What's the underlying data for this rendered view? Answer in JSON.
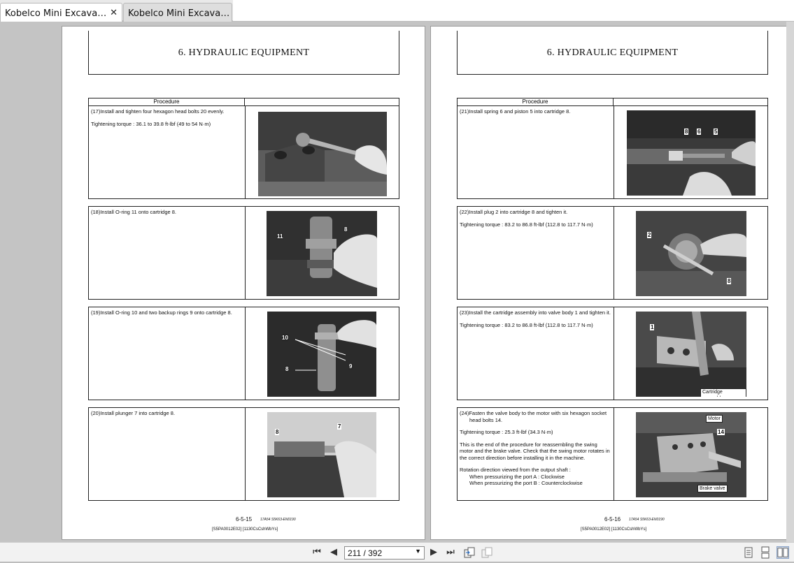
{
  "tabs": [
    {
      "title": "Kobelco Mini Excavator ...",
      "close": "✕"
    },
    {
      "title": "Kobelco Mini Excavato..."
    }
  ],
  "pages": [
    {
      "header": "6. HYDRAULIC EQUIPMENT",
      "column_header": "Procedure",
      "steps": [
        {
          "paragraphs": [
            "(17)Install and tighten four hexagon head bolts 20 evenly.",
            "Tightening torque : 36.1 to 39.8 ft-lbf (49 to 54 N·m)"
          ],
          "callouts": []
        },
        {
          "paragraphs": [
            "(18)Install O-ring 11 onto cartridge 8."
          ],
          "callouts": [
            "11",
            "8"
          ]
        },
        {
          "paragraphs": [
            "(19)Install O-ring 10 and two backup rings 9 onto cartridge 8."
          ],
          "callouts": [
            "10",
            "8",
            "9"
          ]
        },
        {
          "paragraphs": [
            "(20)Install plunger 7 into cartridge 8."
          ],
          "callouts": [
            "8",
            "7"
          ]
        }
      ],
      "page_number": "6-5-15",
      "code": "17A54   S5K63-EN0190",
      "reference": "[S5PA0012E02] [1130CsCshWbYs]"
    },
    {
      "header": "6. HYDRAULIC EQUIPMENT",
      "column_header": "Procedure",
      "steps": [
        {
          "paragraphs": [
            "(21)Install spring 6 and piston 5 into cartridge 8."
          ],
          "callouts": [
            "8",
            "6",
            "5"
          ]
        },
        {
          "paragraphs": [
            "(22)Install plug 2 into cartridge 8 and tighten it.",
            "Tightening torque : 83.2 to 86.8 ft-lbf (112.8 to 117.7 N·m)"
          ],
          "callouts": [
            "2",
            "8"
          ]
        },
        {
          "paragraphs": [
            "(23)Install the cartridge assembly into valve body 1 and tighten it.",
            "Tightening torque : 83.2 to 86.8 ft-lbf (112.8 to 117.7 N·m)"
          ],
          "callouts": [
            "1",
            "Cartridge assembly"
          ]
        },
        {
          "paragraphs": [
            "(24)Fasten the valve body to the motor with six hexagon socket head bolts 14.",
            "Tightening torque : 25.3 ft-lbf (34.3 N·m)",
            "This is the end of the procedure for reassembling the swing motor and the brake valve. Check that the swing motor rotates in the correct direction before installing it in the machine.",
            "Rotation direction viewed from the output shaft :",
            "When pressurizing the port A : Clockwise",
            "When pressurizing the port B : Counterclockwise"
          ],
          "callouts": [
            "Motor",
            "14",
            "Brake valve"
          ]
        }
      ],
      "page_number": "6-5-16",
      "code": "17A54   S5K63-EN0190",
      "reference": "[S5PA0012E02] [1130CsCshWbYs]"
    }
  ],
  "toolbar": {
    "page_display": "211 / 392",
    "first_icon": "first-page-icon",
    "prev_icon": "prev-page-icon",
    "next_icon": "next-page-icon",
    "last_icon": "last-page-icon"
  }
}
